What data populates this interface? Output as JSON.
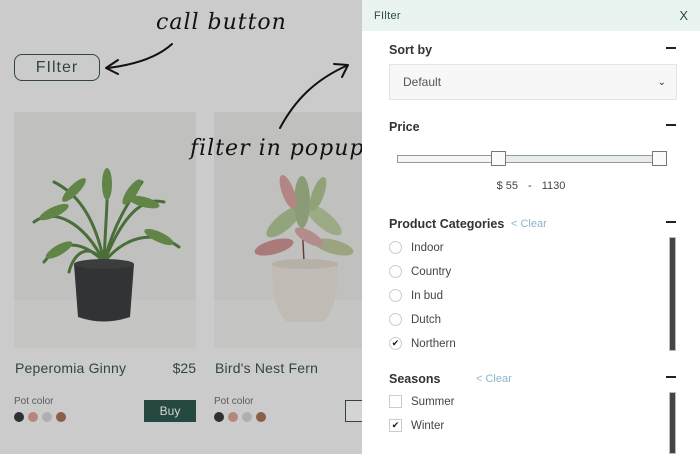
{
  "shop": {
    "filter_button_label": "FIlter",
    "products": [
      {
        "name": "Peperomia Ginny",
        "price": "$25",
        "pot_color_label": "Pot color",
        "buy_label": "Buy",
        "swatches": [
          "#2d2d2d",
          "#d99b8c",
          "#cfcfcf",
          "#a0684e"
        ]
      },
      {
        "name": "Bird's Nest Fern",
        "price": "",
        "pot_color_label": "Pot color",
        "buy_label": "",
        "swatches": [
          "#2d2d2d",
          "#d99b8c",
          "#cfcfcf",
          "#a0684e"
        ]
      }
    ]
  },
  "annotations": {
    "call_button": "call button",
    "filter_in_popup": "filter in popup"
  },
  "panel": {
    "title": "FIlter",
    "close_label": "X",
    "sort": {
      "title": "Sort by",
      "selected": "Default"
    },
    "price": {
      "title": "Price",
      "min": "$ 55",
      "separator": "-",
      "max": "1130",
      "range_low_fraction": 0.37,
      "range_high_fraction": 1.0
    },
    "categories": {
      "title": "Product Categories",
      "clear_label": "< Clear",
      "options": [
        {
          "label": "Indoor",
          "checked": false
        },
        {
          "label": "Country",
          "checked": false
        },
        {
          "label": "In bud",
          "checked": false
        },
        {
          "label": "Dutch",
          "checked": false
        },
        {
          "label": "Northern",
          "checked": true
        }
      ]
    },
    "seasons": {
      "title": "Seasons",
      "clear_label": "< Clear",
      "options": [
        {
          "label": "Summer",
          "checked": false
        },
        {
          "label": "Winter",
          "checked": true
        }
      ]
    }
  },
  "colors": {
    "brand_green": "#1f4d43",
    "header_tint": "#e9f3ef",
    "clear_link": "#8bb6c9"
  }
}
